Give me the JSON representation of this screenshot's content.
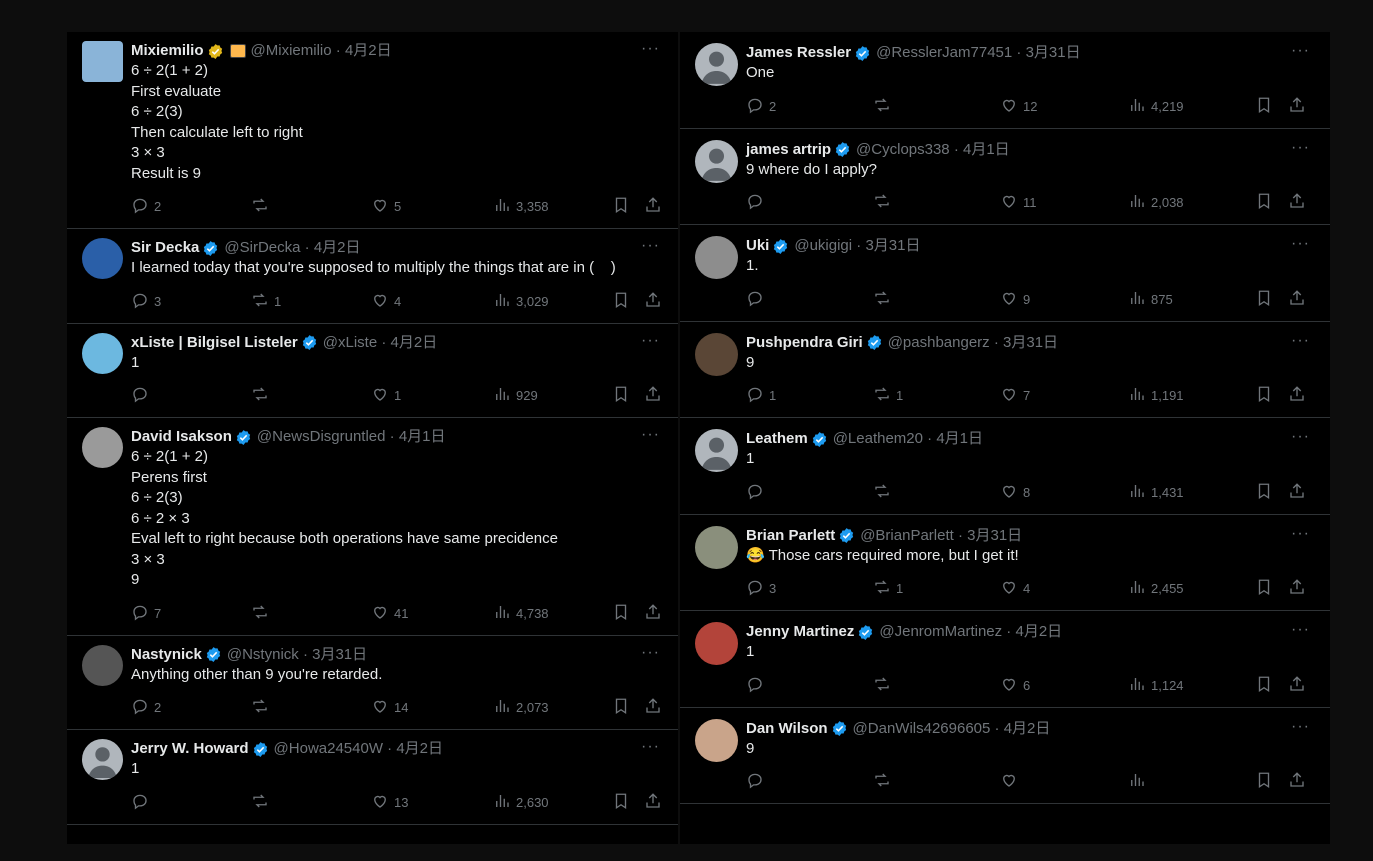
{
  "left_column": [
    {
      "name": "Mixiemilio",
      "badge": "gold",
      "extra_badge": true,
      "handle": "@Mixiemilio",
      "date": "4月2日",
      "text": "6 ÷ 2(1 + 2)\nFirst evaluate\n6 ÷ 2(3)\nThen calculate left to right\n3 × 3\nResult is 9",
      "replies": "2",
      "reposts": "",
      "likes": "5",
      "views": "3,358",
      "avatar_color": "#8ab4d8",
      "avatar_shape": "square"
    },
    {
      "name": "Sir Decka",
      "badge": "blue",
      "handle": "@SirDecka",
      "date": "4月2日",
      "text": "I learned today that you're supposed to multiply the things that are in (    )",
      "replies": "3",
      "reposts": "1",
      "likes": "4",
      "views": "3,029",
      "avatar_color": "#2a5fa8"
    },
    {
      "name": "xListe | Bilgisel Listeler",
      "badge": "blue",
      "handle": "@xListe",
      "date": "4月2日",
      "text": "1",
      "replies": "",
      "reposts": "",
      "likes": "1",
      "views": "929",
      "avatar_color": "#6cb8e0"
    },
    {
      "name": "David Isakson",
      "badge": "blue",
      "handle": "@NewsDisgruntled",
      "date": "4月1日",
      "text": "6 ÷ 2(1 + 2)\nPerens first\n6 ÷ 2(3)\n6 ÷ 2 × 3\nEval left to right because both operations have same precidence\n3 × 3\n9",
      "replies": "7",
      "reposts": "",
      "likes": "41",
      "views": "4,738",
      "avatar_color": "#9a9a9a"
    },
    {
      "name": "Nastynick",
      "badge": "blue",
      "handle": "@Nstynick",
      "date": "3月31日",
      "text": "Anything other than 9 you're retarded.",
      "replies": "2",
      "reposts": "",
      "likes": "14",
      "views": "2,073",
      "avatar_color": "#555555"
    },
    {
      "name": "Jerry W. Howard",
      "badge": "blue",
      "handle": "@Howa24540W",
      "date": "4月2日",
      "text": "1",
      "replies": "",
      "reposts": "",
      "likes": "13",
      "views": "2,630",
      "avatar_color": "#b0b6bc"
    }
  ],
  "right_column": [
    {
      "name": "James Ressler",
      "badge": "blue",
      "handle": "@ResslerJam77451",
      "date": "3月31日",
      "text": "One",
      "replies": "2",
      "reposts": "",
      "likes": "12",
      "views": "4,219",
      "avatar_color": "#b0b6bc"
    },
    {
      "name": "james artrip",
      "badge": "blue",
      "handle": "@Cyclops338",
      "date": "4月1日",
      "text": "9 where do I apply?",
      "replies": "",
      "reposts": "",
      "likes": "11",
      "views": "2,038",
      "avatar_color": "#b0b6bc"
    },
    {
      "name": "Uki",
      "badge": "blue",
      "handle": "@ukigigi",
      "date": "3月31日",
      "text": "1.",
      "replies": "",
      "reposts": "",
      "likes": "9",
      "views": "875",
      "avatar_color": "#8d8d8d"
    },
    {
      "name": "Pushpendra Giri",
      "badge": "blue",
      "handle": "@pashbangerz",
      "date": "3月31日",
      "text": "9",
      "replies": "1",
      "reposts": "1",
      "likes": "7",
      "views": "1,191",
      "avatar_color": "#5a4636"
    },
    {
      "name": "Leathem",
      "badge": "blue",
      "handle": "@Leathem20",
      "date": "4月1日",
      "text": "1",
      "replies": "",
      "reposts": "",
      "likes": "8",
      "views": "1,431",
      "avatar_color": "#b0b6bc"
    },
    {
      "name": "Brian Parlett",
      "badge": "blue",
      "handle": "@BrianParlett",
      "date": "3月31日",
      "text": "😂 Those cars required more, but I get it!",
      "replies": "3",
      "reposts": "1",
      "likes": "4",
      "views": "2,455",
      "avatar_color": "#8a8f7c"
    },
    {
      "name": "Jenny Martinez",
      "badge": "blue",
      "handle": "@JenromMartinez",
      "date": "4月2日",
      "text": "1",
      "replies": "",
      "reposts": "",
      "likes": "6",
      "views": "1,124",
      "avatar_color": "#b3443a"
    },
    {
      "name": "Dan Wilson",
      "badge": "blue",
      "handle": "@DanWils42696605",
      "date": "4月2日",
      "text": "9",
      "replies": "",
      "reposts": "",
      "likes": "",
      "views": "",
      "avatar_color": "#c9a48a"
    }
  ],
  "colors": {
    "verified_blue": "#1d9bf0",
    "verified_gold": "#e2b719",
    "muted": "#71767b",
    "divider": "#2f3336"
  }
}
